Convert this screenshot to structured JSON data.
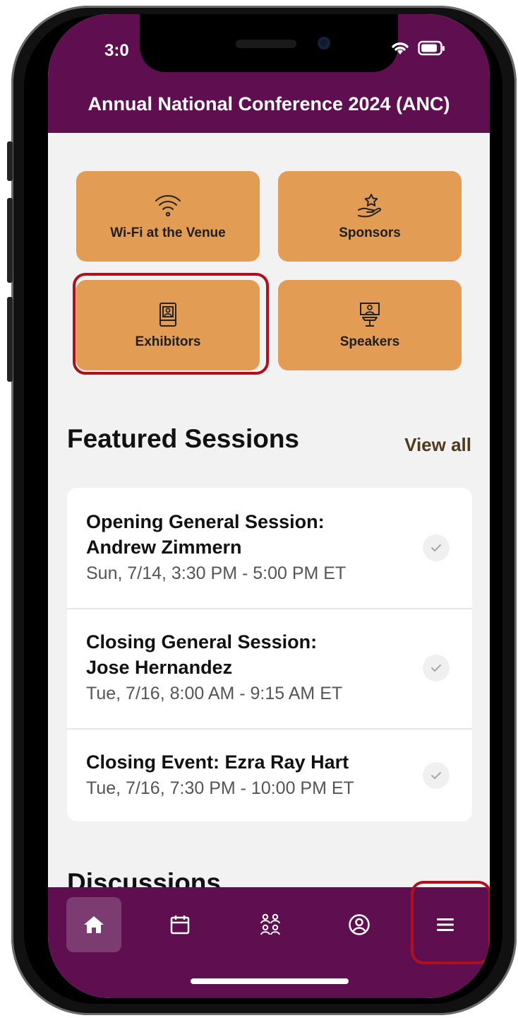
{
  "status_bar": {
    "time": "3:0"
  },
  "header": {
    "title": "Annual National Conference 2024 (ANC)"
  },
  "tiles": [
    {
      "label": "Wi-Fi at the Venue",
      "icon": "wifi-icon"
    },
    {
      "label": "Sponsors",
      "icon": "hand-star-icon"
    },
    {
      "label": "Exhibitors",
      "icon": "booth-icon"
    },
    {
      "label": "Speakers",
      "icon": "podium-icon"
    }
  ],
  "featured": {
    "title": "Featured Sessions",
    "view_all": "View all",
    "sessions": [
      {
        "title_line1": "Opening General Session:",
        "title_line2": "Andrew Zimmern",
        "time": "Sun, 7/14, 3:30 PM - 5:00 PM ET"
      },
      {
        "title_line1": "Closing General Session:",
        "title_line2": "Jose Hernandez",
        "time": "Tue, 7/16, 8:00 AM - 9:15 AM ET"
      },
      {
        "title_line1": "Closing Event: Ezra Ray Hart",
        "time": "Tue, 7/16, 7:30 PM - 10:00 PM ET"
      }
    ]
  },
  "next_section_partial": "Discussions",
  "tab_bar": [
    {
      "name": "home",
      "icon": "home-icon",
      "active": true
    },
    {
      "name": "schedule",
      "icon": "calendar-icon",
      "active": false
    },
    {
      "name": "attendees",
      "icon": "people-icon",
      "active": false
    },
    {
      "name": "profile",
      "icon": "profile-icon",
      "active": false
    },
    {
      "name": "menu",
      "icon": "menu-icon",
      "active": false
    }
  ],
  "colors": {
    "brand_purple": "#5f0f4f",
    "tile_orange": "#e39c54",
    "highlight_red": "#b0101a",
    "background": "#f3f2f2"
  }
}
